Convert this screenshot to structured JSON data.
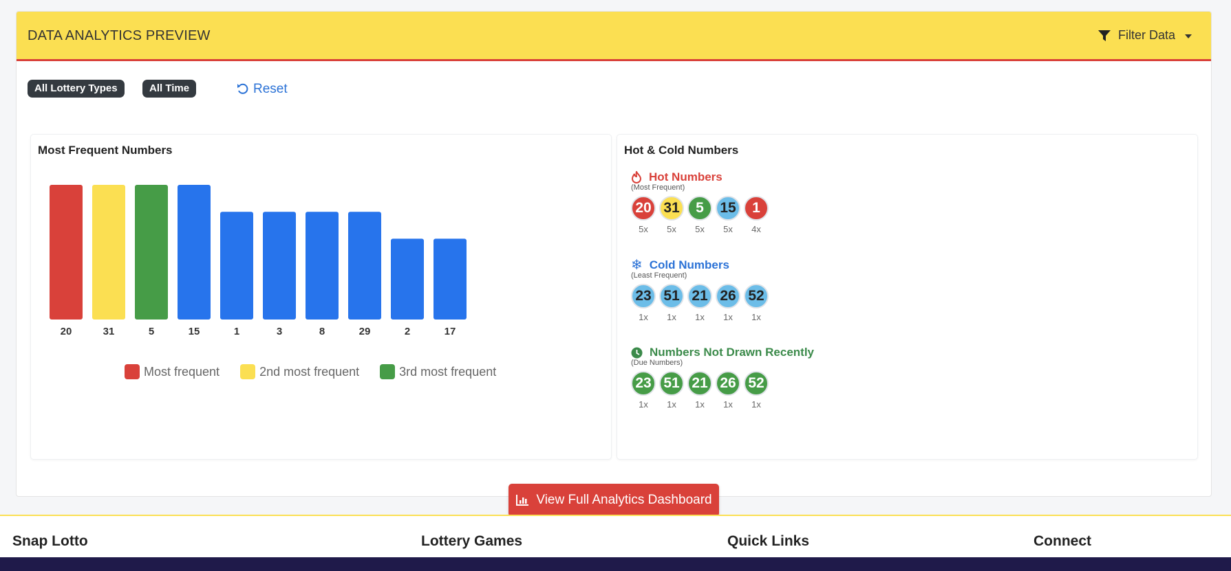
{
  "header": {
    "title": "DATA ANALYTICS PREVIEW",
    "filter_label": "Filter Data"
  },
  "filters": {
    "badges": [
      "All Lottery Types",
      "All Time"
    ],
    "reset_label": "Reset"
  },
  "frequency_panel": {
    "title": "Most Frequent Numbers"
  },
  "chart_data": {
    "type": "bar",
    "categories": [
      "20",
      "31",
      "5",
      "15",
      "1",
      "3",
      "8",
      "29",
      "2",
      "17"
    ],
    "values": [
      5,
      5,
      5,
      5,
      4,
      4,
      4,
      4,
      3,
      3
    ],
    "bar_colors": [
      "#d9413a",
      "#fbdf52",
      "#469c47",
      "#2774ec",
      "#2774ec",
      "#2774ec",
      "#2774ec",
      "#2774ec",
      "#2774ec",
      "#2774ec"
    ],
    "legend": [
      {
        "label": "Most frequent",
        "color": "#d9413a"
      },
      {
        "label": "2nd most frequent",
        "color": "#fbdf52"
      },
      {
        "label": "3rd most frequent",
        "color": "#469c47"
      }
    ],
    "ylim": [
      0,
      5
    ],
    "title": "",
    "xlabel": "",
    "ylabel": ""
  },
  "hot_cold_panel": {
    "title": "Hot & Cold Numbers",
    "hot": {
      "title": "Hot Numbers",
      "subtitle": "(Most Frequent)",
      "balls": [
        {
          "number": "20",
          "count": "5x",
          "color": "#d9413a",
          "text_color": "#ffffff"
        },
        {
          "number": "31",
          "count": "5x",
          "color": "#fbdf52",
          "text_color": "#222222"
        },
        {
          "number": "5",
          "count": "5x",
          "color": "#469c47",
          "text_color": "#ffffff"
        },
        {
          "number": "15",
          "count": "5x",
          "color": "#6cbde8",
          "text_color": "#222222"
        },
        {
          "number": "1",
          "count": "4x",
          "color": "#d9413a",
          "text_color": "#ffffff"
        }
      ]
    },
    "cold": {
      "title": "Cold Numbers",
      "subtitle": "(Least Frequent)",
      "balls": [
        {
          "number": "23",
          "count": "1x",
          "color": "#6cbde8",
          "text_color": "#222222"
        },
        {
          "number": "51",
          "count": "1x",
          "color": "#6cbde8",
          "text_color": "#222222"
        },
        {
          "number": "21",
          "count": "1x",
          "color": "#6cbde8",
          "text_color": "#222222"
        },
        {
          "number": "26",
          "count": "1x",
          "color": "#6cbde8",
          "text_color": "#222222"
        },
        {
          "number": "52",
          "count": "1x",
          "color": "#6cbde8",
          "text_color": "#222222"
        }
      ]
    },
    "due": {
      "title": "Numbers Not Drawn Recently",
      "subtitle": "(Due Numbers)",
      "balls": [
        {
          "number": "23",
          "count": "1x",
          "color": "#469c47",
          "text_color": "#ffffff"
        },
        {
          "number": "51",
          "count": "1x",
          "color": "#469c47",
          "text_color": "#ffffff"
        },
        {
          "number": "21",
          "count": "1x",
          "color": "#469c47",
          "text_color": "#ffffff"
        },
        {
          "number": "26",
          "count": "1x",
          "color": "#469c47",
          "text_color": "#ffffff"
        },
        {
          "number": "52",
          "count": "1x",
          "color": "#469c47",
          "text_color": "#ffffff"
        }
      ]
    }
  },
  "cta": {
    "label": "View Full Analytics Dashboard"
  },
  "footer": {
    "headings": [
      "Snap Lotto",
      "Lottery Games",
      "Quick Links",
      "Connect"
    ]
  },
  "colors": {
    "accent_yellow": "#fbdf52",
    "accent_red": "#d9413a",
    "link_blue": "#2b72d6",
    "hot_red": "#d9413a",
    "cold_blue": "#2b72d6",
    "due_green": "#3b8a4a"
  },
  "icons": [
    "filter-icon",
    "undo-icon",
    "fire-icon",
    "snowflake-icon",
    "clock-icon",
    "chart-icon"
  ]
}
